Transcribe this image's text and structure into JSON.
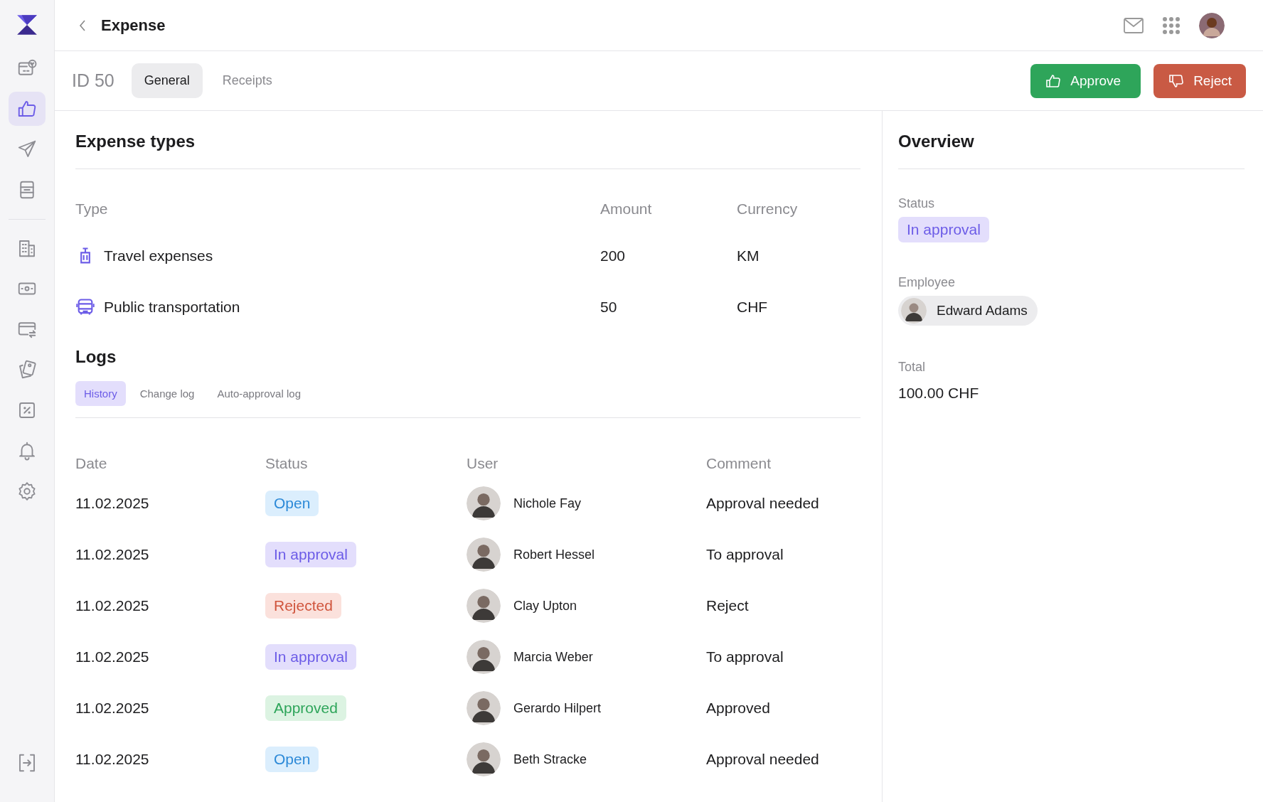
{
  "header": {
    "title": "Expense"
  },
  "sidebar": {
    "groups": [
      [
        {
          "kind": "card-check",
          "selected": false
        },
        {
          "kind": "thumb",
          "selected": true
        },
        {
          "kind": "send",
          "selected": false
        },
        {
          "kind": "document",
          "selected": false
        }
      ],
      [
        {
          "kind": "building",
          "selected": false
        },
        {
          "kind": "money",
          "selected": false
        },
        {
          "kind": "card-swap",
          "selected": false
        },
        {
          "kind": "tags",
          "selected": false
        },
        {
          "kind": "percent",
          "selected": false
        },
        {
          "kind": "bell",
          "selected": false
        },
        {
          "kind": "gear",
          "selected": false
        }
      ]
    ]
  },
  "record": {
    "id": "ID 50",
    "tabs": [
      {
        "label": "General",
        "selected": true
      },
      {
        "label": "Receipts",
        "selected": false
      }
    ],
    "actions": [
      {
        "label": "Approve",
        "kind": "approve"
      },
      {
        "label": "Reject",
        "kind": "reject"
      }
    ]
  },
  "expense_types": {
    "title": "Expense types",
    "columns": [
      "Type",
      "Amount",
      "Currency"
    ],
    "rows": [
      {
        "kind": "luggage",
        "type": "Travel expenses",
        "amount": "200",
        "currency": "KM"
      },
      {
        "kind": "bus",
        "type": "Public transportation",
        "amount": "50",
        "currency": "CHF"
      }
    ]
  },
  "logs": {
    "title": "Logs",
    "tabs": [
      {
        "label": "History",
        "selected": true
      },
      {
        "label": "Change log",
        "selected": false
      },
      {
        "label": "Auto-approval log",
        "selected": false
      }
    ],
    "columns": [
      "Date",
      "Status",
      "User",
      "Comment"
    ],
    "rows": [
      {
        "kind": "open",
        "date": "11.02.2025",
        "status": "Open",
        "user": "Nichole Fay",
        "comment": "Approval needed"
      },
      {
        "kind": "in_approval",
        "date": "11.02.2025",
        "status": "In approval",
        "user": "Robert Hessel",
        "comment": "To approval"
      },
      {
        "kind": "rejected",
        "date": "11.02.2025",
        "status": "Rejected",
        "user": "Clay Upton",
        "comment": "Reject"
      },
      {
        "kind": "in_approval",
        "date": "11.02.2025",
        "status": "In approval",
        "user": "Marcia Weber",
        "comment": "To approval"
      },
      {
        "kind": "approved",
        "date": "11.02.2025",
        "status": "Approved",
        "user": "Gerardo Hilpert",
        "comment": "Approved"
      },
      {
        "kind": "open",
        "date": "11.02.2025",
        "status": "Open",
        "user": "Beth Stracke",
        "comment": "Approval needed"
      }
    ]
  },
  "overview": {
    "title": "Overview",
    "status_label": "Status",
    "status": {
      "text": "In approval",
      "kind": "in_approval"
    },
    "employee_label": "Employee",
    "employee": "Edward Adams",
    "total_label": "Total",
    "total": "100.00 CHF"
  }
}
